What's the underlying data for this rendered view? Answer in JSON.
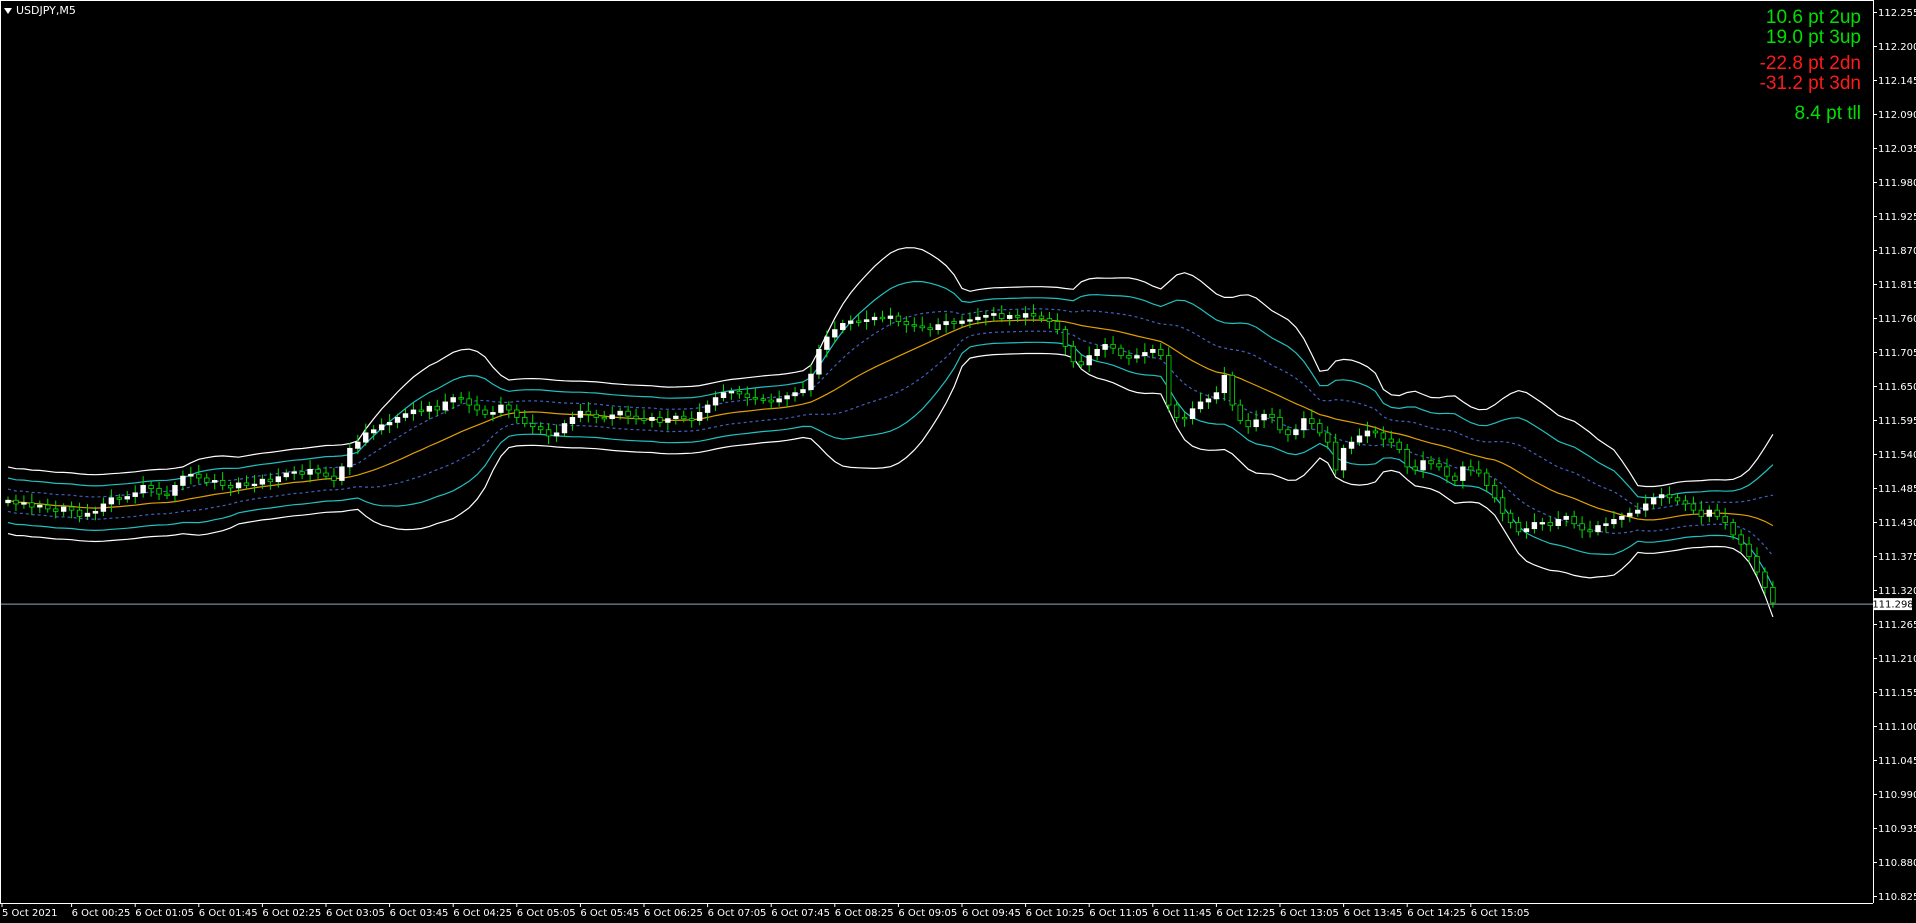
{
  "window": {
    "symbol_label": "USDJPY,M5"
  },
  "stats": [
    {
      "text": "10.6 pt 2up",
      "color": "#00e000"
    },
    {
      "text": "19.0 pt 3up",
      "color": "#00e000"
    },
    {
      "text": "-22.8 pt 2dn",
      "color": "#ff1a1a"
    },
    {
      "text": "-31.2 pt 3dn",
      "color": "#ff1a1a"
    },
    {
      "text": "8.4 pt tll",
      "color": "#00e000"
    }
  ],
  "current_price": "111.298",
  "colors": {
    "background": "#000000",
    "bull_body": "#ffffff",
    "candle_wick": "#00e000",
    "band_outer": "#ffffff",
    "band_inner": "#20c0c0",
    "band_dashed": "#4060c0",
    "midline": "#e0a000",
    "price_line": "#8fa8b8"
  },
  "chart_data": {
    "type": "line",
    "instrument": "USDJPY",
    "timeframe": "M5",
    "y_tick_labels": [
      "112.255",
      "112.200",
      "112.145",
      "112.090",
      "112.035",
      "111.980",
      "111.925",
      "111.870",
      "111.815",
      "111.760",
      "111.705",
      "111.650",
      "111.595",
      "111.540",
      "111.485",
      "111.430",
      "111.375",
      "111.320",
      "111.265",
      "111.210",
      "111.155",
      "111.100",
      "111.045",
      "110.990",
      "110.935",
      "110.880",
      "110.825"
    ],
    "ylim": [
      110.8,
      112.28
    ],
    "x_tick_labels": [
      "5 Oct 2021",
      "6 Oct 00:25",
      "6 Oct 01:05",
      "6 Oct 01:45",
      "6 Oct 02:25",
      "6 Oct 03:05",
      "6 Oct 03:45",
      "6 Oct 04:25",
      "6 Oct 05:05",
      "6 Oct 05:45",
      "6 Oct 06:25",
      "6 Oct 07:05",
      "6 Oct 07:45",
      "6 Oct 08:25",
      "6 Oct 09:05",
      "6 Oct 09:45",
      "6 Oct 10:25",
      "6 Oct 11:05",
      "6 Oct 11:45",
      "6 Oct 12:25",
      "6 Oct 13:05",
      "6 Oct 13:45",
      "6 Oct 14:25",
      "6 Oct 15:05"
    ],
    "bars_per_x_label": 8,
    "close_prices": [
      111.466,
      111.46,
      111.462,
      111.455,
      111.458,
      111.452,
      111.448,
      111.455,
      111.45,
      111.44,
      111.445,
      111.448,
      111.46,
      111.47,
      111.468,
      111.472,
      111.478,
      111.49,
      111.485,
      111.476,
      111.474,
      111.49,
      111.505,
      111.508,
      111.502,
      111.495,
      111.498,
      111.49,
      111.486,
      111.494,
      111.49,
      111.492,
      111.5,
      111.496,
      111.504,
      111.51,
      111.512,
      111.508,
      111.516,
      111.51,
      111.505,
      111.498,
      111.52,
      111.55,
      111.56,
      111.575,
      111.58,
      111.588,
      111.592,
      111.6,
      111.606,
      111.612,
      111.61,
      111.618,
      111.612,
      111.625,
      111.632,
      111.63,
      111.62,
      111.612,
      111.605,
      111.608,
      111.62,
      111.612,
      111.6,
      111.59,
      111.585,
      111.58,
      111.57,
      111.575,
      111.59,
      111.6,
      111.61,
      111.605,
      111.6,
      111.598,
      111.604,
      111.61,
      111.602,
      111.598,
      111.595,
      111.6,
      111.592,
      111.598,
      111.602,
      111.598,
      111.595,
      111.608,
      111.62,
      111.632,
      111.64,
      111.642,
      111.638,
      111.632,
      111.63,
      111.628,
      111.625,
      111.63,
      111.635,
      111.64,
      111.645,
      111.67,
      111.71,
      111.73,
      111.742,
      111.752,
      111.756,
      111.755,
      111.758,
      111.762,
      111.76,
      111.764,
      111.755,
      111.75,
      111.748,
      111.745,
      111.742,
      111.75,
      111.755,
      111.752,
      111.756,
      111.758,
      111.762,
      111.765,
      111.768,
      111.76,
      111.765,
      111.762,
      111.768,
      111.764,
      111.76,
      111.755,
      111.742,
      111.715,
      111.69,
      111.685,
      111.7,
      111.71,
      111.718,
      111.712,
      111.7,
      111.696,
      111.7,
      111.705,
      111.71,
      111.7,
      111.62,
      111.6,
      111.598,
      111.614,
      111.625,
      111.63,
      111.64,
      111.668,
      111.62,
      111.595,
      111.585,
      111.596,
      111.605,
      111.6,
      111.58,
      111.572,
      111.58,
      111.598,
      111.59,
      111.575,
      111.56,
      111.515,
      111.55,
      111.56,
      111.57,
      111.578,
      111.575,
      111.565,
      111.56,
      111.548,
      111.52,
      111.515,
      111.53,
      111.525,
      111.52,
      111.505,
      111.498,
      111.52,
      111.515,
      111.51,
      111.49,
      111.47,
      111.445,
      111.43,
      111.415,
      111.42,
      111.43,
      111.43,
      111.425,
      111.435,
      111.44,
      111.428,
      111.418,
      111.415,
      111.425,
      111.428,
      111.435,
      111.44,
      111.445,
      111.45,
      111.46,
      111.47,
      111.475,
      111.47,
      111.465,
      111.46,
      111.45,
      111.44,
      111.45,
      111.44,
      111.43,
      111.41,
      111.395,
      111.375,
      111.35,
      111.325,
      111.3
    ],
    "series": [
      {
        "name": "",
        "values": []
      }
    ]
  }
}
